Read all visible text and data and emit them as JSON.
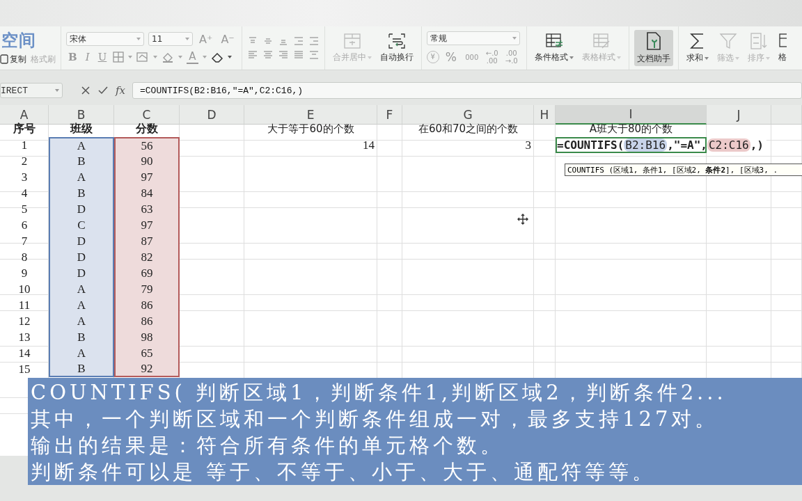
{
  "ribbon": {
    "logo": "空间",
    "clipboard": [
      {
        "label": "复制",
        "kind": "copy",
        "disabled": false
      },
      {
        "label": "格式刷",
        "kind": "painter",
        "disabled": true
      }
    ],
    "font": {
      "name": "宋体",
      "size": "11",
      "size_buttons": [
        "A⁺",
        "A⁻"
      ],
      "styles": [
        {
          "label": "B",
          "kind": "bold"
        },
        {
          "label": "I",
          "kind": "italic"
        },
        {
          "label": "U",
          "kind": "underline"
        }
      ],
      "color_button": "A"
    },
    "number_format": "常规",
    "number_buttons": [
      "¥",
      "%",
      "000",
      "←.0 .00",
      ".00 →.0"
    ],
    "command_groups": [
      [
        {
          "label": "合并居中",
          "kind": "merge",
          "disabled": true,
          "dropdown": true,
          "selected": false
        },
        {
          "label": "自动换行",
          "kind": "wrap",
          "disabled": false,
          "dropdown": false,
          "selected": false
        }
      ],
      [
        {
          "label": "条件格式",
          "kind": "cond",
          "disabled": false,
          "dropdown": true,
          "selected": false
        },
        {
          "label": "表格样式",
          "kind": "tablestyle",
          "disabled": true,
          "dropdown": true,
          "selected": false
        }
      ],
      [
        {
          "label": "文档助手",
          "kind": "assistant",
          "disabled": false,
          "dropdown": false,
          "selected": true
        }
      ],
      [
        {
          "label": "求和",
          "kind": "sum",
          "disabled": false,
          "dropdown": true,
          "selected": false
        },
        {
          "label": "筛选",
          "kind": "filter",
          "disabled": true,
          "dropdown": true,
          "selected": false
        },
        {
          "label": "排序",
          "kind": "sort",
          "disabled": true,
          "dropdown": true,
          "selected": false
        },
        {
          "label": "格",
          "kind": "table",
          "disabled": false,
          "dropdown": false,
          "selected": false
        }
      ]
    ]
  },
  "formula_bar": {
    "name_box": "IRECT",
    "fx": "fx",
    "formula": "=COUNTIFS(B2:B16,\"=A\",C2:C16,)"
  },
  "sheet": {
    "columns": [
      {
        "label": "A",
        "selected": false
      },
      {
        "label": "B",
        "selected": false,
        "color": "#5a7db3"
      },
      {
        "label": "C",
        "selected": false,
        "color": "#b35a5a"
      },
      {
        "label": "D",
        "selected": false
      },
      {
        "label": "E",
        "selected": false
      },
      {
        "label": "F",
        "selected": false
      },
      {
        "label": "G",
        "selected": false
      },
      {
        "label": "H",
        "selected": false
      },
      {
        "label": "I",
        "selected": true
      },
      {
        "label": "J",
        "selected": false
      }
    ],
    "rows": [
      {
        "kind": "header",
        "A": "序号",
        "B": "班级",
        "C": "分数",
        "E": "大于等于60的个数",
        "G": "在60和70之间的个数",
        "I": "A班大于80的个数"
      },
      {
        "kind": "data",
        "A": "1",
        "B": "A",
        "C": "56",
        "E": "14",
        "G": "3"
      },
      {
        "kind": "data",
        "A": "2",
        "B": "B",
        "C": "90"
      },
      {
        "kind": "data",
        "A": "3",
        "B": "A",
        "C": "97"
      },
      {
        "kind": "data",
        "A": "4",
        "B": "B",
        "C": "84"
      },
      {
        "kind": "data",
        "A": "5",
        "B": "D",
        "C": "63"
      },
      {
        "kind": "data",
        "A": "6",
        "B": "C",
        "C": "97"
      },
      {
        "kind": "data",
        "A": "7",
        "B": "D",
        "C": "87"
      },
      {
        "kind": "data",
        "A": "8",
        "B": "D",
        "C": "82"
      },
      {
        "kind": "data",
        "A": "9",
        "B": "D",
        "C": "69"
      },
      {
        "kind": "data",
        "A": "10",
        "B": "A",
        "C": "79"
      },
      {
        "kind": "data",
        "A": "11",
        "B": "A",
        "C": "86"
      },
      {
        "kind": "data",
        "A": "12",
        "B": "A",
        "C": "86"
      },
      {
        "kind": "data",
        "A": "13",
        "B": "B",
        "C": "98"
      },
      {
        "kind": "data",
        "A": "14",
        "B": "A",
        "C": "65"
      },
      {
        "kind": "data",
        "A": "15",
        "B": "B",
        "C": "92"
      }
    ],
    "edit_cell": {
      "parts": [
        {
          "text": "=COUNTIFS("
        },
        {
          "text": "B2:B16",
          "color": "#c8d4ea"
        },
        {
          "text": ",\"=A\","
        },
        {
          "text": "C2:C16",
          "color": "#eccaca"
        },
        {
          "text": ",)"
        }
      ]
    },
    "tooltip": "COUNTIFS (区域1, 条件1, [区域2, **条件2**], [区域3, ."
  },
  "caption": [
    "COUNTIFS( 判断区域1，判断条件1,判断区域2，判断条件2...",
    "其中，一个判断区域和一个判断条件组成一对，最多支持127对。",
    "输出的结果是：符合所有条件的单元格个数。",
    "判断条件可以是 等于、不等于、小于、大于、通配符等等。"
  ]
}
